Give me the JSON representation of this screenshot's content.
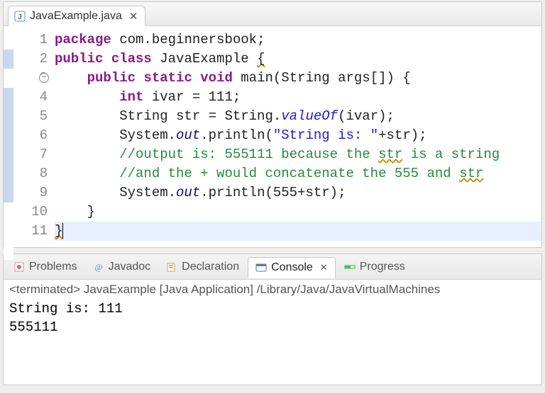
{
  "editor": {
    "tab": {
      "filename": "JavaExample.java"
    },
    "lines": [
      {
        "n": "1",
        "mark": "",
        "tokens": [
          [
            "kw",
            "package"
          ],
          [
            "plain",
            " com.beginnersbook;"
          ]
        ]
      },
      {
        "n": "2",
        "mark": "blue",
        "tokens": [
          [
            "kw",
            "public"
          ],
          [
            "plain",
            " "
          ],
          [
            "kw",
            "class"
          ],
          [
            "plain",
            " JavaExample "
          ],
          [
            "plain-warn",
            "{"
          ]
        ]
      },
      {
        "n": "3",
        "mark": "",
        "fold": true,
        "tokens": [
          [
            "plain",
            "    "
          ],
          [
            "kw",
            "public"
          ],
          [
            "plain",
            " "
          ],
          [
            "kw",
            "static"
          ],
          [
            "plain",
            " "
          ],
          [
            "kw",
            "void"
          ],
          [
            "plain",
            " main(String args[]) {"
          ]
        ]
      },
      {
        "n": "4",
        "mark": "blue",
        "tokens": [
          [
            "plain",
            "        "
          ],
          [
            "kw",
            "int"
          ],
          [
            "plain",
            " ivar = 111;"
          ]
        ]
      },
      {
        "n": "5",
        "mark": "blue",
        "tokens": [
          [
            "plain",
            "        String str = String."
          ],
          [
            "italic",
            "valueOf"
          ],
          [
            "plain",
            "(ivar);"
          ]
        ]
      },
      {
        "n": "6",
        "mark": "blue",
        "tokens": [
          [
            "plain",
            "        System."
          ],
          [
            "italic-dark",
            "out"
          ],
          [
            "plain",
            ".println("
          ],
          [
            "str",
            "\"String is: \""
          ],
          [
            "plain",
            "+str);"
          ]
        ]
      },
      {
        "n": "7",
        "mark": "blue",
        "tokens": [
          [
            "plain",
            "        "
          ],
          [
            "comment",
            "//output is: 555111 because the "
          ],
          [
            "comment-warn",
            "str"
          ],
          [
            "comment",
            " is a string"
          ]
        ]
      },
      {
        "n": "8",
        "mark": "blue",
        "tokens": [
          [
            "plain",
            "        "
          ],
          [
            "comment",
            "//and the + would concatenate the 555 and "
          ],
          [
            "comment-warn",
            "str"
          ]
        ]
      },
      {
        "n": "9",
        "mark": "blue",
        "tokens": [
          [
            "plain",
            "        System."
          ],
          [
            "italic-dark",
            "out"
          ],
          [
            "plain",
            ".println(555+str);"
          ]
        ]
      },
      {
        "n": "10",
        "mark": "",
        "tokens": [
          [
            "plain",
            "    }"
          ]
        ]
      },
      {
        "n": "11",
        "mark": "",
        "hl": true,
        "cursor": true,
        "tokens": [
          [
            "plain-warn",
            "}"
          ]
        ]
      }
    ]
  },
  "views": {
    "tabs": [
      {
        "label": "Problems",
        "icon": "problems",
        "active": false
      },
      {
        "label": "Javadoc",
        "icon": "javadoc",
        "active": false
      },
      {
        "label": "Declaration",
        "icon": "declaration",
        "active": false
      },
      {
        "label": "Console",
        "icon": "console",
        "active": true
      },
      {
        "label": "Progress",
        "icon": "progress",
        "active": false
      }
    ]
  },
  "console": {
    "header": "<terminated> JavaExample [Java Application] /Library/Java/JavaVirtualMachines",
    "lines": [
      "String is: 111",
      "555111"
    ]
  }
}
